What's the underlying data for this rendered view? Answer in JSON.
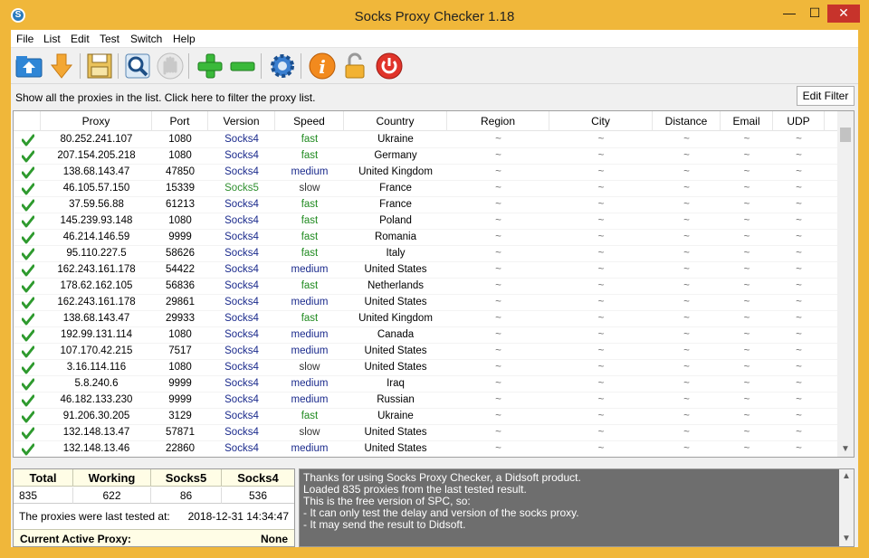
{
  "window": {
    "title": "Socks Proxy Checker 1.18",
    "min_glyph": "—",
    "max_glyph": "☐",
    "close_glyph": "✕"
  },
  "menu": [
    "File",
    "List",
    "Edit",
    "Test",
    "Switch",
    "Help"
  ],
  "toolbar": {
    "icons": [
      "upload-icon",
      "download-icon",
      "save-icon",
      "search-icon",
      "stop-hand-icon",
      "add-icon",
      "remove-icon",
      "settings-gear-icon",
      "info-icon",
      "unlock-icon",
      "power-icon"
    ]
  },
  "filter": {
    "text": "Show all the proxies in the list. Click here to filter the proxy list.",
    "button": "Edit Filter"
  },
  "grid": {
    "columns": [
      "Proxy",
      "Port",
      "Version",
      "Speed",
      "Country",
      "Region",
      "City",
      "Distance",
      "Email",
      "UDP"
    ],
    "rows": [
      {
        "proxy": "80.252.241.107",
        "port": "1080",
        "version": "Socks4",
        "speed": "fast",
        "country": "Ukraine"
      },
      {
        "proxy": "207.154.205.218",
        "port": "1080",
        "version": "Socks4",
        "speed": "fast",
        "country": "Germany"
      },
      {
        "proxy": "138.68.143.47",
        "port": "47850",
        "version": "Socks4",
        "speed": "medium",
        "country": "United Kingdom"
      },
      {
        "proxy": "46.105.57.150",
        "port": "15339",
        "version": "Socks5",
        "speed": "slow",
        "country": "France"
      },
      {
        "proxy": "37.59.56.88",
        "port": "61213",
        "version": "Socks4",
        "speed": "fast",
        "country": "France"
      },
      {
        "proxy": "145.239.93.148",
        "port": "1080",
        "version": "Socks4",
        "speed": "fast",
        "country": "Poland"
      },
      {
        "proxy": "46.214.146.59",
        "port": "9999",
        "version": "Socks4",
        "speed": "fast",
        "country": "Romania"
      },
      {
        "proxy": "95.110.227.5",
        "port": "58626",
        "version": "Socks4",
        "speed": "fast",
        "country": "Italy"
      },
      {
        "proxy": "162.243.161.178",
        "port": "54422",
        "version": "Socks4",
        "speed": "medium",
        "country": "United States"
      },
      {
        "proxy": "178.62.162.105",
        "port": "56836",
        "version": "Socks4",
        "speed": "fast",
        "country": "Netherlands"
      },
      {
        "proxy": "162.243.161.178",
        "port": "29861",
        "version": "Socks4",
        "speed": "medium",
        "country": "United States"
      },
      {
        "proxy": "138.68.143.47",
        "port": "29933",
        "version": "Socks4",
        "speed": "fast",
        "country": "United Kingdom"
      },
      {
        "proxy": "192.99.131.114",
        "port": "1080",
        "version": "Socks4",
        "speed": "medium",
        "country": "Canada"
      },
      {
        "proxy": "107.170.42.215",
        "port": "7517",
        "version": "Socks4",
        "speed": "medium",
        "country": "United States"
      },
      {
        "proxy": "3.16.114.116",
        "port": "1080",
        "version": "Socks4",
        "speed": "slow",
        "country": "United States"
      },
      {
        "proxy": "5.8.240.6",
        "port": "9999",
        "version": "Socks4",
        "speed": "medium",
        "country": "Iraq"
      },
      {
        "proxy": "46.182.133.230",
        "port": "9999",
        "version": "Socks4",
        "speed": "medium",
        "country": "Russian"
      },
      {
        "proxy": "91.206.30.205",
        "port": "3129",
        "version": "Socks4",
        "speed": "fast",
        "country": "Ukraine"
      },
      {
        "proxy": "132.148.13.47",
        "port": "57871",
        "version": "Socks4",
        "speed": "slow",
        "country": "United States"
      },
      {
        "proxy": "132.148.13.46",
        "port": "22860",
        "version": "Socks4",
        "speed": "medium",
        "country": "United States"
      }
    ],
    "empty_value": "~",
    "status_icon": "checkmark-icon"
  },
  "stats": {
    "headers": [
      "Total",
      "Working",
      "Socks5",
      "Socks4"
    ],
    "values": [
      "835",
      "622",
      "86",
      "536"
    ],
    "last_tested_label": "The proxies were last tested at:",
    "last_tested_value": "2018-12-31 14:34:47",
    "active_proxy_label": "Current Active Proxy:",
    "active_proxy_value": "None"
  },
  "log": [
    "Thanks for using Socks Proxy Checker, a Didsoft product.",
    "Loaded 835 proxies from the last tested result.",
    "This is the free version of SPC, so:",
    "- It can only test the delay and version of the socks proxy.",
    "- It may send the result to Didsoft."
  ],
  "colors": {
    "frame": "#f0b73a",
    "socks4": "#1a2a8c",
    "socks5": "#2f8f2f",
    "fast": "#1f8a1f",
    "medium": "#1a2a8c",
    "log_bg": "#6e6e6e"
  }
}
